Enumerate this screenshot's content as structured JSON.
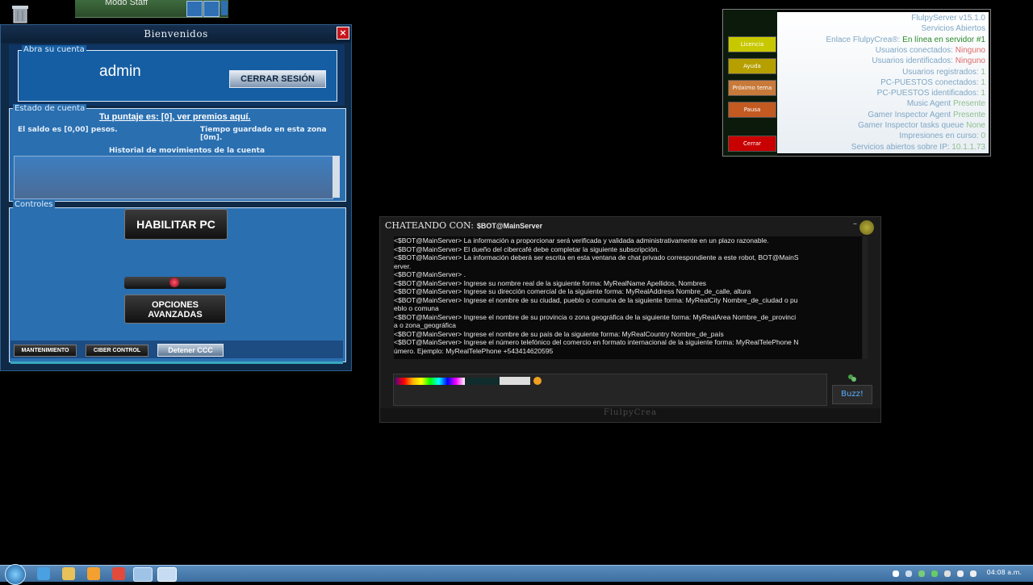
{
  "desktop": {
    "modo_label": "Modo Staff"
  },
  "welcome": {
    "title": "Bienvenidos",
    "close": "×",
    "account_legend": "Abra su cuenta",
    "username": "admin",
    "logout": "CERRAR SESIÓN",
    "status_legend": "Estado de cuenta",
    "score_link": "Tu puntaje es: [0], ver premios aquí.",
    "balance": "El saldo es [0,00] pesos.",
    "time_saved": "Tiempo guardado en esta zona [0m].",
    "history_label": "Historial de movimientos de la cuenta",
    "controls_legend": "Controles",
    "enable_pc": "HABILITAR PC",
    "advanced": [
      "OPCIONES",
      "AVANZADAS"
    ],
    "footer_buttons": [
      "MANTENIMIENTO",
      "CIBER CONTROL",
      "Detener CCC"
    ]
  },
  "server": {
    "buttons": [
      "Licencia",
      "Ayuda",
      "Próximo tema",
      "Pausa",
      "Cerrar"
    ],
    "button_colors": [
      "#c8c800",
      "#b5a000",
      "#c77a3a",
      "#c35a22",
      "#c80000"
    ],
    "lines": [
      {
        "label": "FlulpyServer v15.1.0",
        "value": ""
      },
      {
        "label": "Servicios Abiertos",
        "value": ""
      },
      {
        "label": "Enlace FlulpyCrea®:",
        "value": "En línea en servidor #1"
      },
      {
        "label": "Usuarios conectados:",
        "value": "Ninguno"
      },
      {
        "label": "Usuarios identificados:",
        "value": "Ninguno"
      },
      {
        "label": "Usuarios registrados:",
        "value": "1"
      },
      {
        "label": "PC-PUESTOS conectados:",
        "value": "1"
      },
      {
        "label": "PC-PUESTOS identificados:",
        "value": "1"
      },
      {
        "label": "Music Agent",
        "value": "Presente"
      },
      {
        "label": "Gamer Inspector Agent",
        "value": "Presente"
      },
      {
        "label": "Gamer Inspector tasks queue",
        "value": "None"
      },
      {
        "label": "Impresiones en curso:",
        "value": "0"
      },
      {
        "label": "Servicios abiertos sobre IP:",
        "value": "10.1.1.73"
      }
    ]
  },
  "chat": {
    "title_prefix": "Chateando con:",
    "title_user": "$BOT@MainServer",
    "minimize": "–",
    "lines": [
      "<$BOT@MainServer> La información a proporcionar será verificada y validada administrativamente en un plazo razonable.",
      "<$BOT@MainServer> El dueño del cibercafé debe completar la siguiente subscripción.",
      "<$BOT@MainServer> La información deberá ser escrita en esta ventana de chat privado correspondiente a este robot, BOT@MainS",
      "erver.",
      "<$BOT@MainServer> .",
      "<$BOT@MainServer> Ingrese su nombre real de la siguiente forma: MyRealName Apellidos, Nombres",
      "<$BOT@MainServer> Ingrese su dirección comercial de la siguiente forma: MyRealAddress Nombre_de_calle, altura",
      "<$BOT@MainServer> Ingrese el nombre de su ciudad, pueblo o comuna de la siguiente forma: MyRealCity Nombre_de_ciudad o pu",
      "eblo o comuna",
      "<$BOT@MainServer> Ingrese el nombre de su provincia o zona geográfica de la siguiente forma: MyRealArea Nombre_de_provinci",
      "a o zona_geográfica",
      "<$BOT@MainServer> Ingrese el nombre de su país de la siguiente forma: MyRealCountry Nombre_de_país",
      "<$BOT@MainServer> Ingrese el número telefónico del comercio en formato internacional de la siguiente forma: MyRealTelePhone N",
      "úmero. Ejemplo: MyRealTelePhone +543414620595"
    ],
    "buzz": "Buzz!",
    "footer": "FlulpyCrea"
  },
  "taskbar": {
    "clock": "04:08 a.m."
  }
}
